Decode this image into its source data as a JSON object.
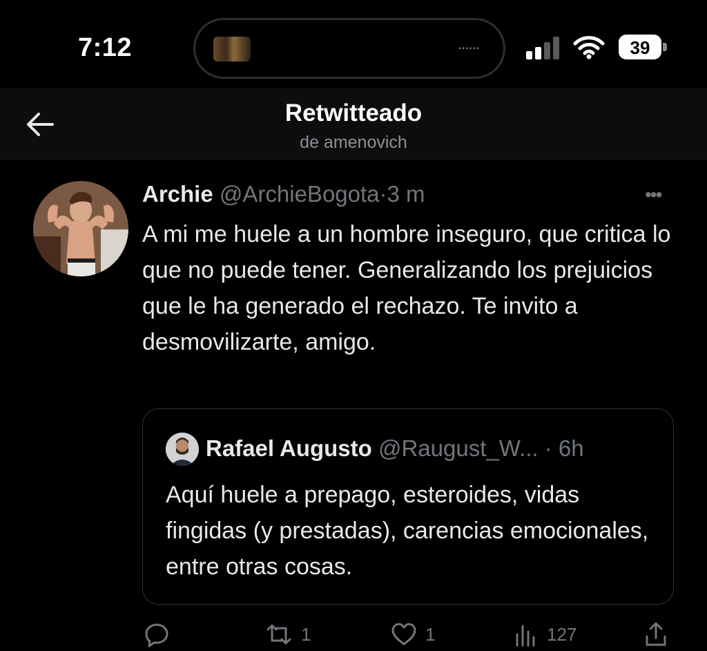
{
  "status_bar": {
    "time": "7:12",
    "battery": "39",
    "more_dots": "......"
  },
  "header": {
    "title": "Retwitteado",
    "subtitle": "de amenovich",
    "back_icon": "arrow-left-icon"
  },
  "tweet": {
    "name": "Archie",
    "handle": "@ArchieBogota",
    "separator": "·",
    "time": "3 m",
    "more": "•••",
    "text": "A mi me huele a un hombre inseguro, que critica lo que no puede tener. Generalizando los prejuicios que le ha generado el rechazo. Te invito a desmovilizarte, amigo."
  },
  "quoted_tweet": {
    "name": "Rafael Augusto",
    "handle": "@Raugust_W...",
    "separator": "·",
    "time": "6h",
    "text": "Aquí huele a prepago, esteroides, vidas fingidas (y prestadas), carencias emocionales, entre otras cosas."
  },
  "actions": {
    "reply_icon": "reply-icon",
    "retweet_count": "1",
    "like_count": "1",
    "views_count": "127",
    "share_icon": "share-icon"
  },
  "colors": {
    "background": "#000000",
    "text": "#e7e9ea",
    "muted": "#71767b",
    "border": "#2f3336"
  }
}
